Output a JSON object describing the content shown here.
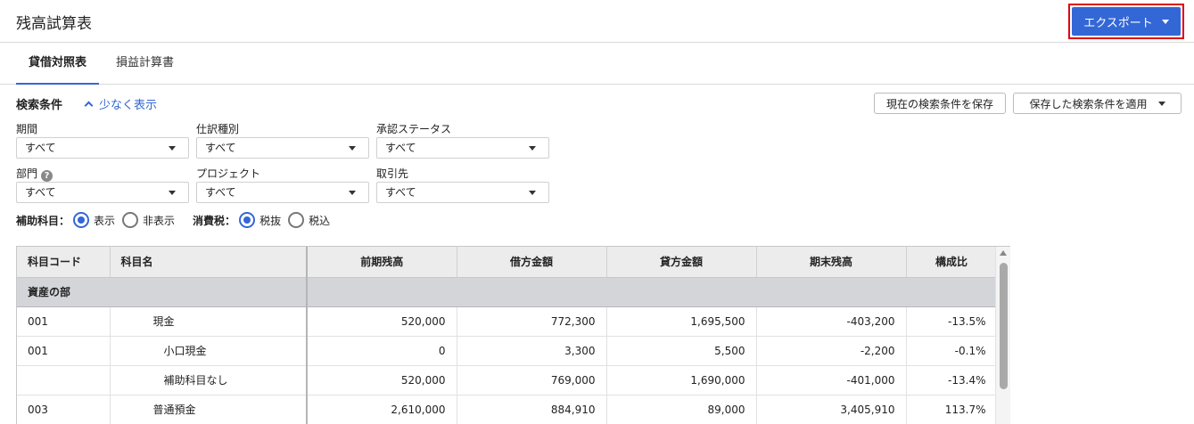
{
  "header": {
    "title": "残高試算表",
    "export_label": "エクスポート"
  },
  "tabs": [
    {
      "label": "貸借対照表",
      "active": true
    },
    {
      "label": "損益計算書",
      "active": false
    }
  ],
  "search": {
    "heading": "検索条件",
    "toggle_label": "少なく表示",
    "save_button": "現在の検索条件を保存",
    "apply_button": "保存した検索条件を適用",
    "filters": [
      {
        "label": "期間",
        "value": "すべて"
      },
      {
        "label": "仕訳種別",
        "value": "すべて"
      },
      {
        "label": "承認ステータス",
        "value": "すべて"
      },
      {
        "label": "部門",
        "value": "すべて",
        "help_icon": "question-circle-icon"
      },
      {
        "label": "プロジェクト",
        "value": "すべて"
      },
      {
        "label": "取引先",
        "value": "すべて"
      }
    ],
    "sub_account": {
      "label": "補助科目：",
      "options": [
        "表示",
        "非表示"
      ],
      "selected": "表示"
    },
    "tax": {
      "label": "消費税：",
      "options": [
        "税抜",
        "税込"
      ],
      "selected": "税抜"
    }
  },
  "table": {
    "columns": [
      "科目コード",
      "科目名",
      "前期残高",
      "借方金額",
      "貸方金額",
      "期末残高",
      "構成比"
    ],
    "section": "資産の部",
    "rows": [
      {
        "code": "001",
        "name": "現金",
        "prev": "520,000",
        "debit": "772,300",
        "credit": "1,695,500",
        "ending": "-403,200",
        "ratio": "-13.5%",
        "level": 1
      },
      {
        "code": "001",
        "name": "小口現金",
        "prev": "0",
        "debit": "3,300",
        "credit": "5,500",
        "ending": "-2,200",
        "ratio": "-0.1%",
        "level": 2
      },
      {
        "code": "",
        "name": "補助科目なし",
        "prev": "520,000",
        "debit": "769,000",
        "credit": "1,690,000",
        "ending": "-401,000",
        "ratio": "-13.4%",
        "level": 2
      },
      {
        "code": "003",
        "name": "普通預金",
        "prev": "2,610,000",
        "debit": "884,910",
        "credit": "89,000",
        "ending": "3,405,910",
        "ratio": "113.7%",
        "level": 1
      }
    ]
  },
  "colors": {
    "accent": "#3367d6",
    "highlight_border": "#e00012",
    "section_bg": "#d3d5d9",
    "header_bg": "#ececec"
  }
}
